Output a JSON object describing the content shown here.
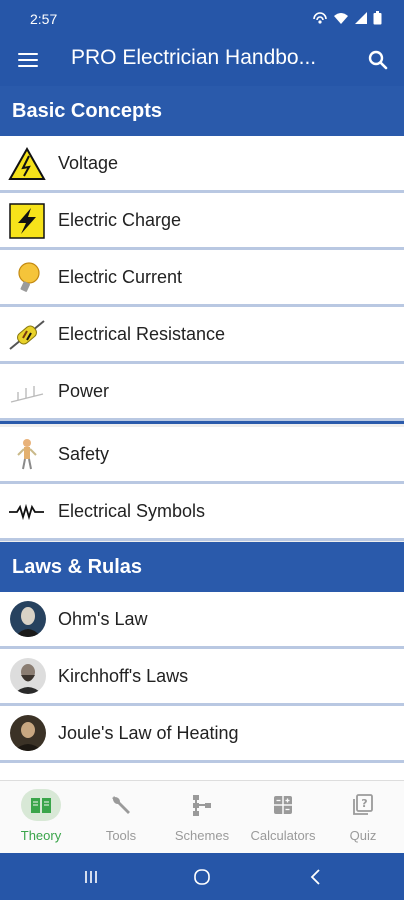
{
  "status_bar": {
    "time": "2:57"
  },
  "app_bar": {
    "title": "PRO Electrician Handbo...",
    "menu_icon": "hamburger-menu-icon",
    "search_icon": "search-icon"
  },
  "sections": [
    {
      "title": "Basic Concepts",
      "items": [
        {
          "label": "Voltage",
          "icon": "voltage-warning-icon"
        },
        {
          "label": "Electric Charge",
          "icon": "lightning-bolt-icon"
        },
        {
          "label": "Electric Current",
          "icon": "light-bulb-icon"
        },
        {
          "label": "Electrical Resistance",
          "icon": "resistor-icon"
        },
        {
          "label": "Power",
          "icon": "power-icon"
        },
        {
          "label": "Safety",
          "icon": "electrician-figure-icon"
        },
        {
          "label": "Electrical Symbols",
          "icon": "resistor-symbol-icon"
        }
      ]
    },
    {
      "title": "Laws & Rulas",
      "items": [
        {
          "label": "Ohm's Law",
          "icon": "ohm-portrait"
        },
        {
          "label": "Kirchhoff's Laws",
          "icon": "kirchhoff-portrait"
        },
        {
          "label": "Joule's Law of Heating",
          "icon": "joule-portrait"
        }
      ]
    }
  ],
  "bottom_nav": [
    {
      "label": "Theory",
      "icon": "book-icon",
      "active": true
    },
    {
      "label": "Tools",
      "icon": "wrench-icon",
      "active": false
    },
    {
      "label": "Schemes",
      "icon": "schematic-icon",
      "active": false
    },
    {
      "label": "Calculators",
      "icon": "calculator-icon",
      "active": false
    },
    {
      "label": "Quiz",
      "icon": "quiz-icon",
      "active": false
    }
  ],
  "colors": {
    "primary": "#2656a8",
    "section": "#2a5aab",
    "active_nav": "#3aa54a"
  }
}
